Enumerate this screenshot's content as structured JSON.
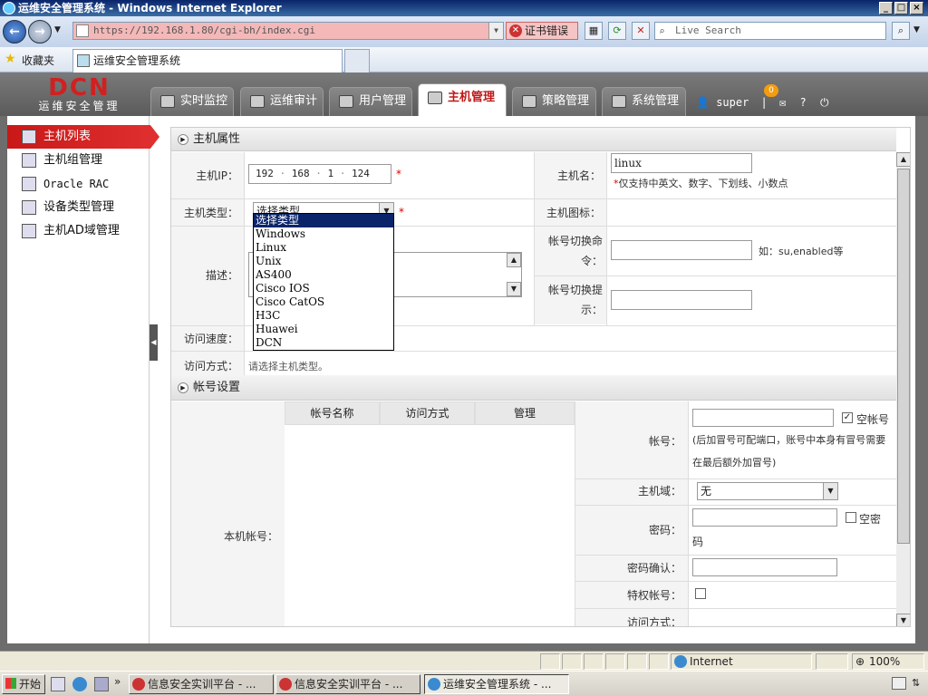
{
  "browser": {
    "window_title": "运维安全管理系统 - Windows Internet Explorer",
    "address": "https://192.168.1.80/cgi-bh/index.cgi",
    "cert_error": "证书错误",
    "search_placeholder": "Live Search",
    "favorites": "收藏夹",
    "tab_title": "运维安全管理系统"
  },
  "app": {
    "logo_big": "DCN",
    "logo_small": "运维安全管理",
    "tabs": [
      {
        "label": "实时监控"
      },
      {
        "label": "运维审计"
      },
      {
        "label": "用户管理"
      },
      {
        "label": "主机管理"
      },
      {
        "label": "策略管理"
      },
      {
        "label": "系统管理"
      }
    ],
    "user": "super",
    "sep": "|",
    "msg_count": "0",
    "help": "?"
  },
  "sidebar": {
    "items": [
      {
        "label": "主机列表"
      },
      {
        "label": "主机组管理"
      },
      {
        "label": "Oracle RAC"
      },
      {
        "label": "设备类型管理"
      },
      {
        "label": "主机AD域管理"
      }
    ]
  },
  "host_props": {
    "section_title": "主机属性",
    "ip_label": "主机IP：",
    "ip": [
      "192",
      "168",
      "1",
      "124"
    ],
    "ip_dot": "·",
    "required": "*",
    "name_label": "主机名：",
    "name_value": "linux",
    "name_hint": "仅支持中英文、数字、下划线、小数点",
    "type_label": "主机类型：",
    "type_value": "选择类型",
    "icon_label": "主机图标：",
    "desc_label": "描述：",
    "switch_cmd_label": "帐号切换命令：",
    "switch_cmd_hint": "如：su,enabled等",
    "switch_prompt_label": "帐号切换提示：",
    "speed_label": "访问速度：",
    "method_label": "访问方式：",
    "method_hint": "请选择主机类型。",
    "type_options": [
      "选择类型",
      "Windows",
      "Linux",
      "Unix",
      "AS400",
      "Cisco IOS",
      "Cisco CatOS",
      "H3C",
      "Huawei",
      "DCN"
    ]
  },
  "account": {
    "section_title": "帐号设置",
    "local_label": "本机帐号：",
    "columns": [
      "帐号名称",
      "访问方式",
      "管理"
    ],
    "acct_label": "帐号：",
    "empty_acct": "空帐号",
    "acct_hint": "(后加冒号可配端口，账号中本身有冒号需要在最后额外加冒号)",
    "domain_label": "主机域：",
    "domain_value": "无",
    "pwd_label": "密码：",
    "empty_pwd": "空密码",
    "pwd_confirm_label": "密码确认：",
    "priv_label": "特权帐号：",
    "method_label": "访问方式："
  },
  "status": {
    "zone": "Internet",
    "zoom": "100%"
  },
  "taskbar": {
    "start": "开始",
    "chevron": "»",
    "tasks": [
      {
        "label": "信息安全实训平台 - ..."
      },
      {
        "label": "信息安全实训平台 - ..."
      },
      {
        "label": "运维安全管理系统 - ..."
      }
    ]
  }
}
